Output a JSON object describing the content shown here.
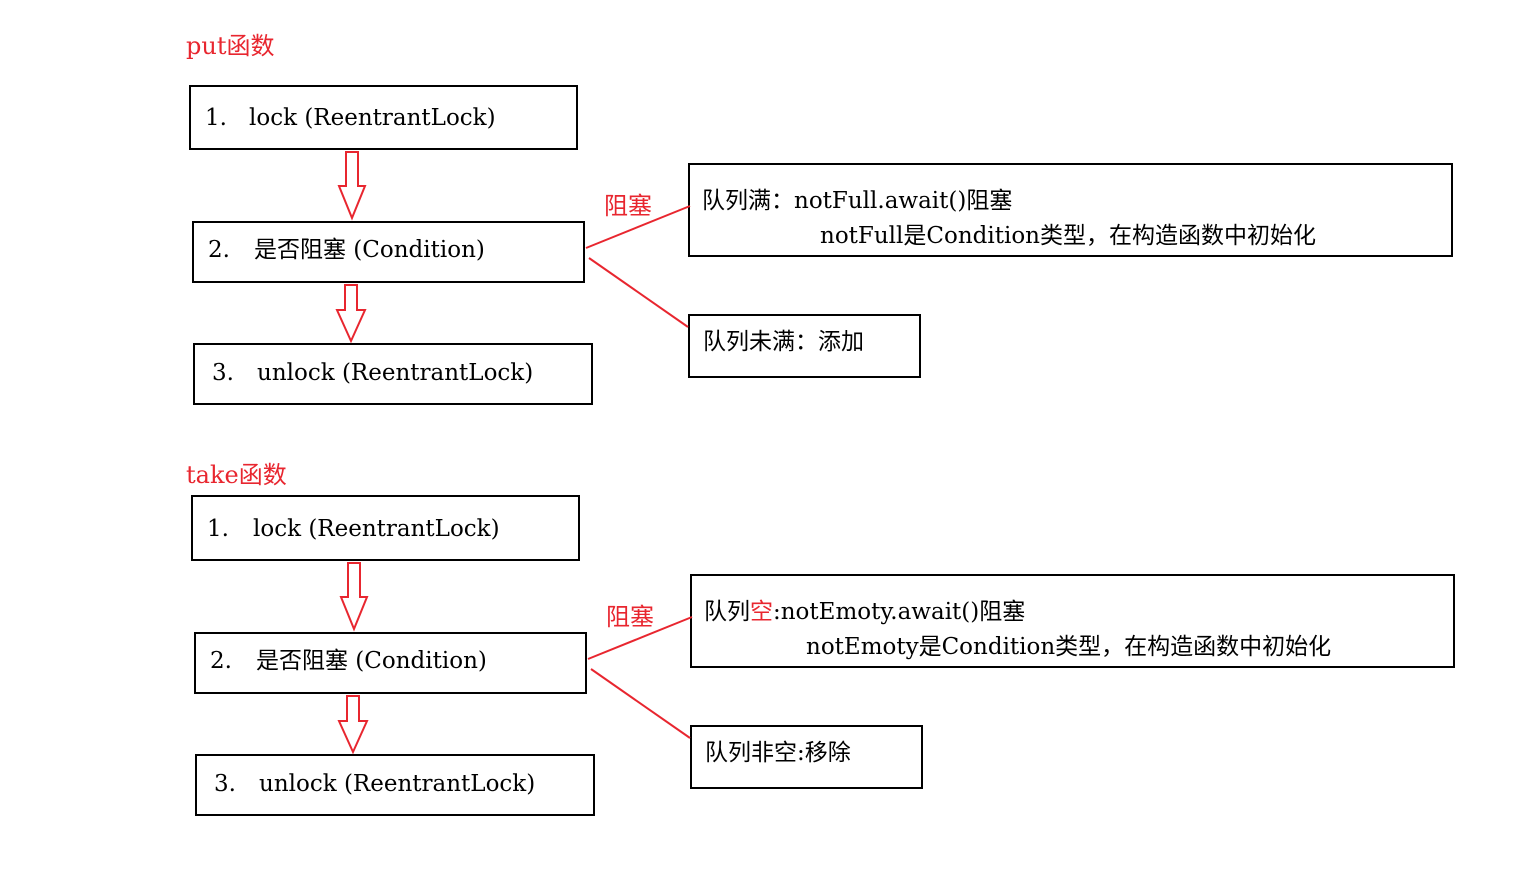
{
  "sections": [
    {
      "title": "put函数",
      "steps": [
        {
          "num": "1.",
          "text": "lock  (ReentrantLock)"
        },
        {
          "num": "2.",
          "text": "是否阻塞 (Condition)"
        },
        {
          "num": "3.",
          "text": "unlock (ReentrantLock)"
        }
      ],
      "block_label": "阻塞",
      "blocked_box": {
        "line1_prefix": "队列满",
        "line1_rest": "：notFull.await()阻塞",
        "line2": "notFull是Condition类型，在构造函数中初始化"
      },
      "ok_box": {
        "prefix": "队列未满",
        "rest": "：添加"
      }
    },
    {
      "title": "take函数",
      "steps": [
        {
          "num": "1.",
          "text": "lock  (ReentrantLock)"
        },
        {
          "num": "2.",
          "text": "是否阻塞 (Condition)"
        },
        {
          "num": "3.",
          "text": "unlock (ReentrantLock)"
        }
      ],
      "block_label": "阻塞",
      "blocked_box": {
        "line1_prefix": "队列",
        "line1_accent": "空",
        "line1_rest": ":notEmoty.await()阻塞",
        "line2": "notEmoty是Condition类型，在构造函数中初始化"
      },
      "ok_box": {
        "prefix": "队列非空",
        "rest": ":移除"
      }
    }
  ],
  "colors": {
    "accent": "#e8262f",
    "box_border": "#000000",
    "text": "#000000"
  }
}
